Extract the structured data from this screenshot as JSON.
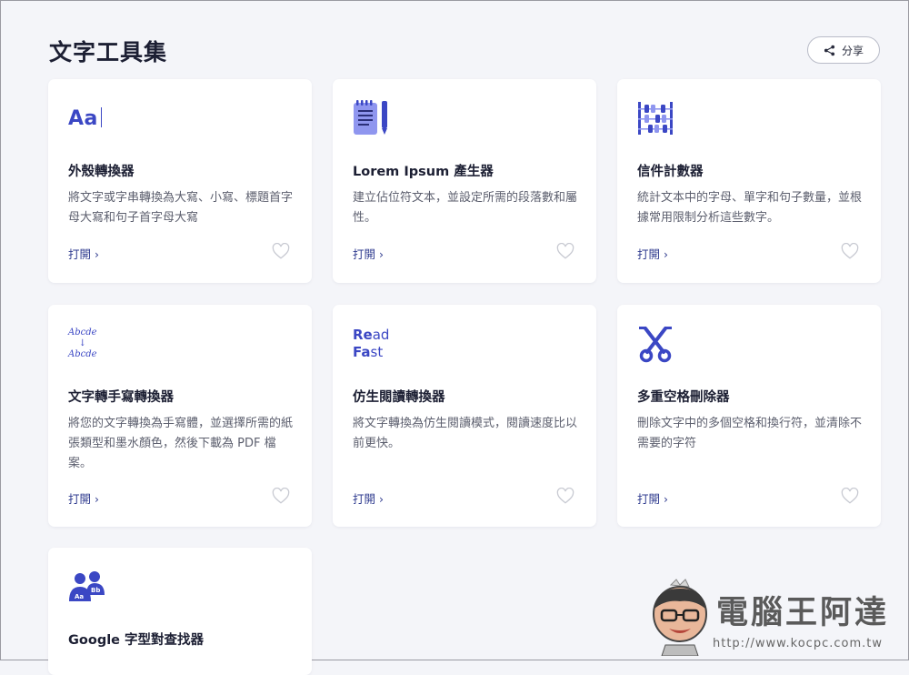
{
  "header": {
    "title": "文字工具集",
    "share_label": "分享"
  },
  "accent_color": "#3b47c4",
  "cards": [
    {
      "title": "外殼轉換器",
      "desc": "將文字或字串轉換為大寫、小寫、標題首字母大寫和句子首字母大寫",
      "open": "打開 ›",
      "icon": "Aa",
      "icon_name": "text-case-icon"
    },
    {
      "title": "Lorem Ipsum 產生器",
      "desc": "建立佔位符文本，並設定所需的段落數和屬性。",
      "open": "打開 ›",
      "icon_name": "notepad-pen-icon"
    },
    {
      "title": "信件計數器",
      "desc": "統計文本中的字母、單字和句子數量，並根據常用限制分析這些數字。",
      "open": "打開 ›",
      "icon_name": "abacus-icon"
    },
    {
      "title": "文字轉手寫轉換器",
      "desc": "將您的文字轉換為手寫體，並選擇所需的紙張類型和墨水顏色，然後下載為 PDF 檔案。",
      "open": "打開 ›",
      "icon_top": "Abcde",
      "icon_arrow": "↓",
      "icon_bottom": "Abcde",
      "icon_name": "handwriting-icon"
    },
    {
      "title": "仿生閱讀轉換器",
      "desc": "將文字轉換為仿生閱讀模式，閱讀速度比以前更快。",
      "open": "打開 ›",
      "icon_line1_bold": "Re",
      "icon_line1_rest": "ad",
      "icon_line2_bold": "Fa",
      "icon_line2_rest": "st",
      "icon_name": "bionic-reading-icon"
    },
    {
      "title": "多重空格刪除器",
      "desc": "刪除文字中的多個空格和換行符，並清除不需要的字符",
      "open": "打開 ›",
      "icon_name": "scissors-icon"
    },
    {
      "title": "Google 字型對查找器",
      "icon_left": "Aa",
      "icon_right": "Bb",
      "icon_name": "font-pair-icon"
    }
  ],
  "watermark": {
    "title": "電腦王阿達",
    "url": "http://www.kocpc.com.tw"
  }
}
